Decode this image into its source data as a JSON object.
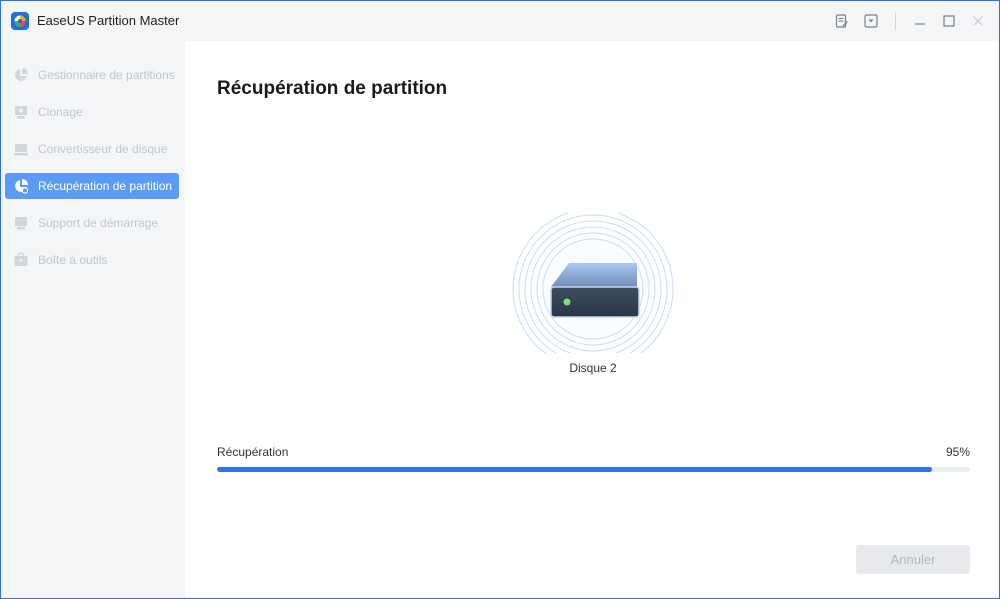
{
  "app": {
    "title": "EaseUS Partition Master",
    "accent_color": "#2f73e6"
  },
  "titlebar": {
    "buttons": [
      {
        "name": "notes-icon"
      },
      {
        "name": "dropdown-icon"
      },
      {
        "name": "minimize-icon"
      },
      {
        "name": "maximize-icon"
      },
      {
        "name": "close-icon"
      }
    ]
  },
  "sidebar": {
    "items": [
      {
        "label": "Gestionnaire de partitions",
        "icon": "pie-chart-icon",
        "active": false
      },
      {
        "label": "Clonage",
        "icon": "clone-icon",
        "active": false
      },
      {
        "label": "Convertisseur de disque",
        "icon": "disk-convert-icon",
        "active": false
      },
      {
        "label": "Récupération de partition",
        "icon": "partition-recovery-icon",
        "active": true
      },
      {
        "label": "Support de démarrage",
        "icon": "boot-media-icon",
        "active": false
      },
      {
        "label": "Boîte à outils",
        "icon": "toolbox-icon",
        "active": false
      }
    ]
  },
  "main": {
    "title": "Récupération de partition",
    "disk_label": "Disque 2",
    "progress": {
      "label": "Récupération",
      "percent_text": "95%",
      "value": 0.95
    },
    "cancel_label": "Annuler"
  }
}
